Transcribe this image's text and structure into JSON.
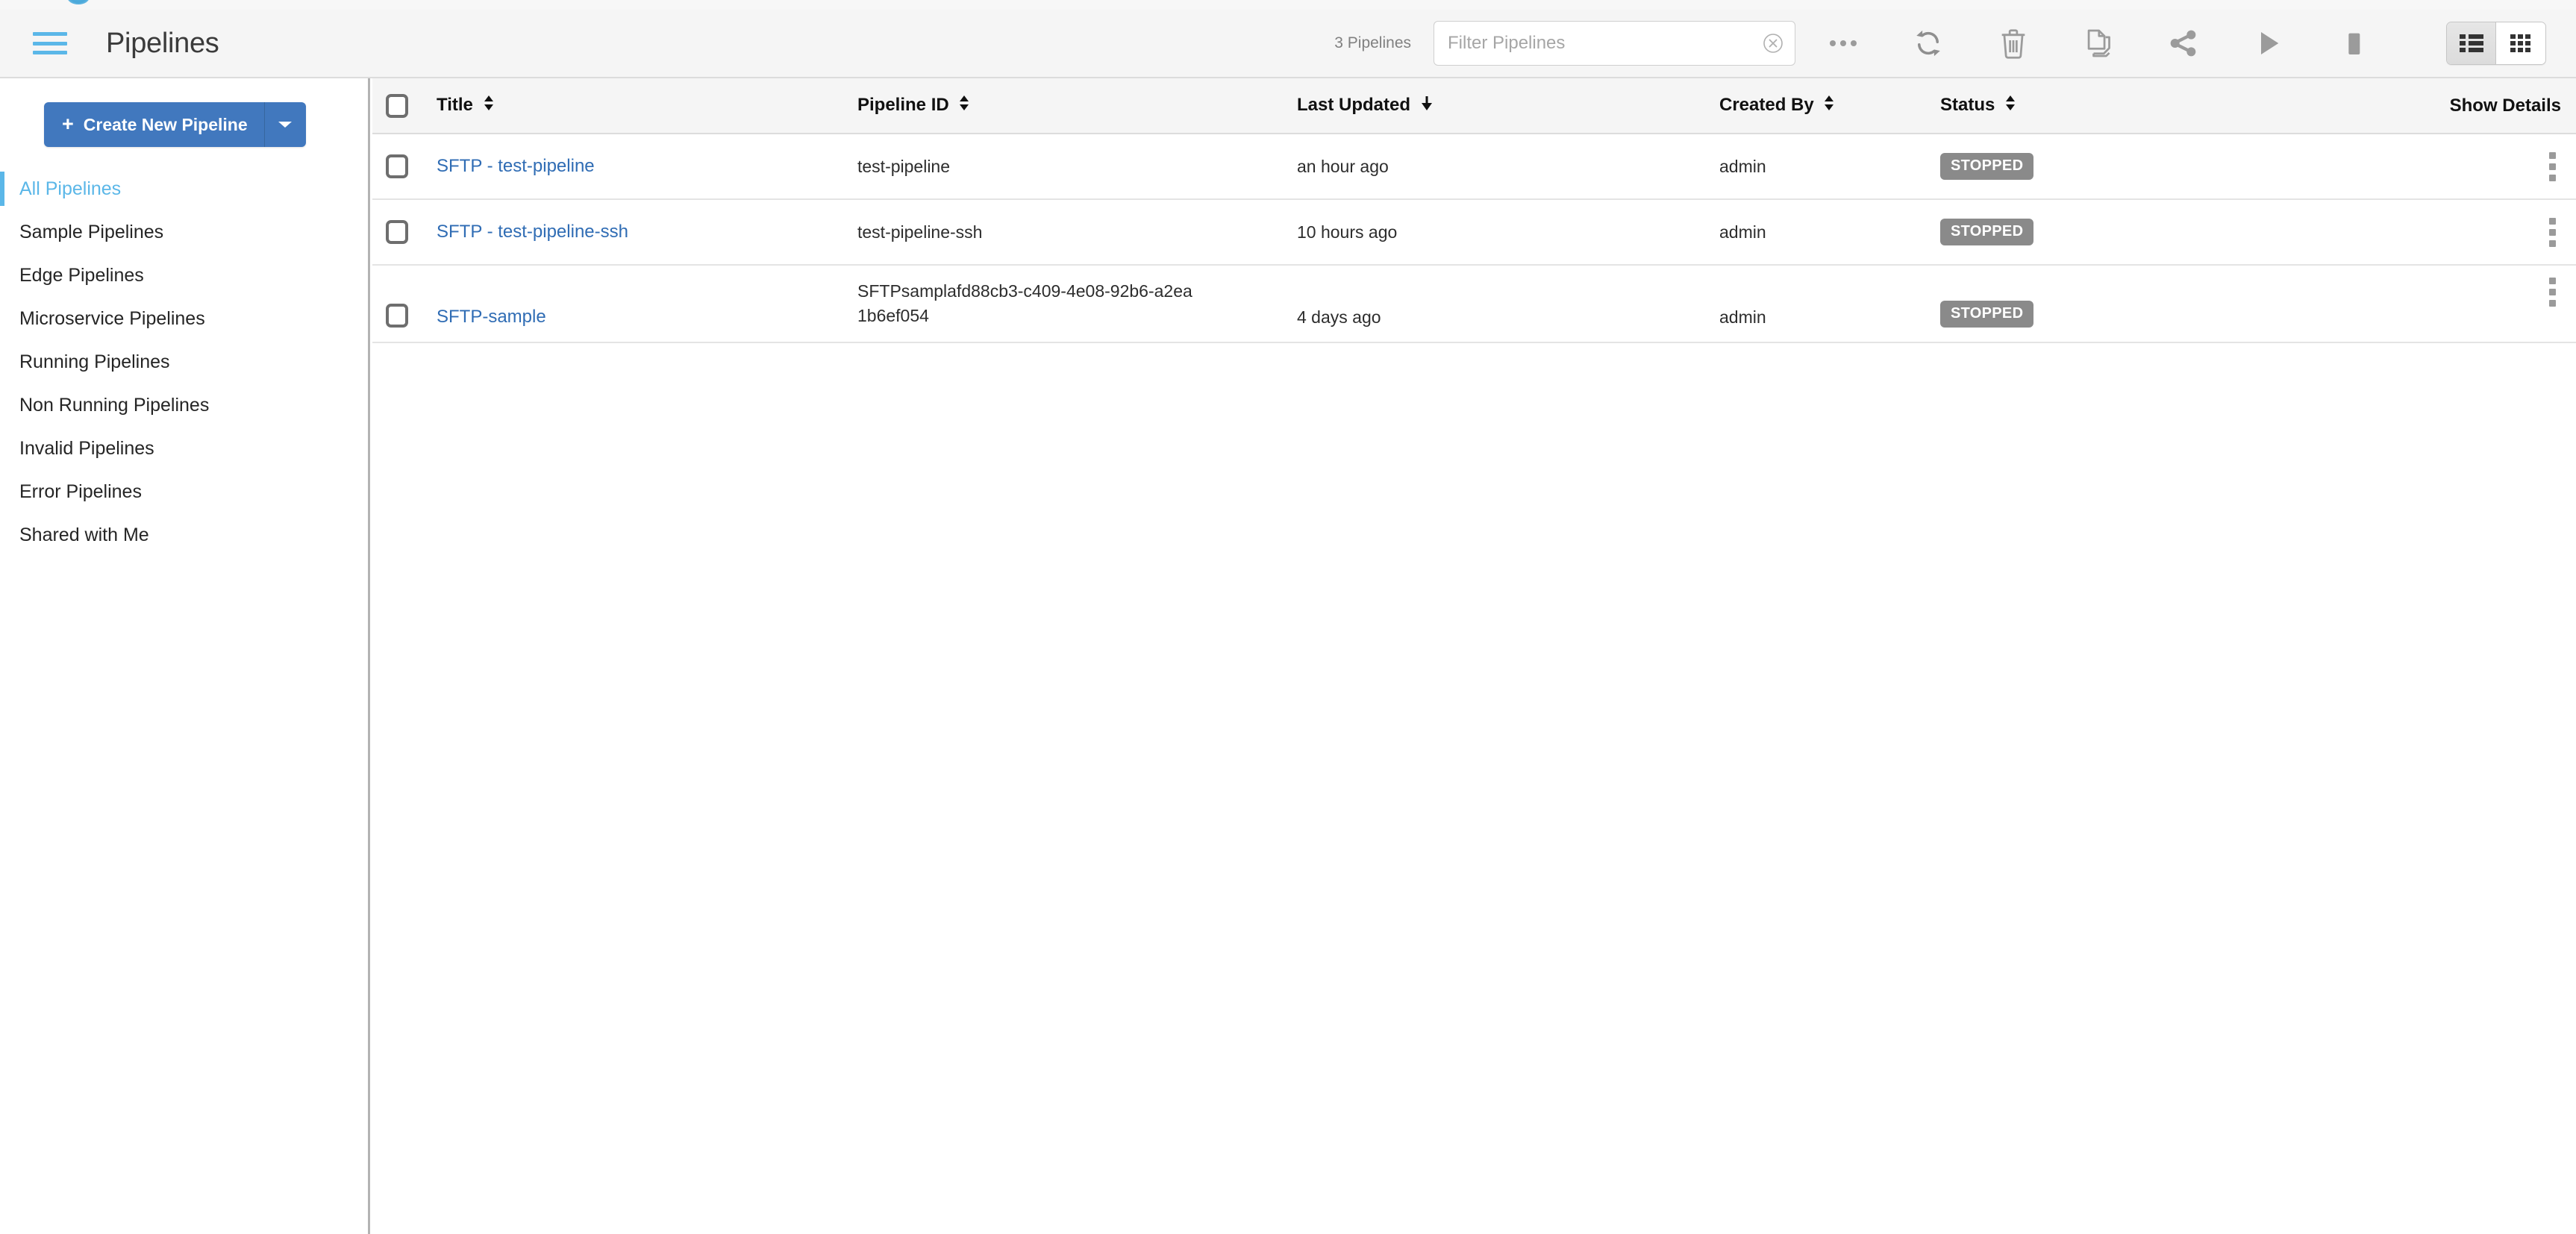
{
  "header": {
    "title": "Pipelines",
    "menu_icon": "hamburger-icon",
    "pipeline_count": "3 Pipelines",
    "filter": {
      "placeholder": "Filter Pipelines",
      "value": ""
    },
    "toolbar": [
      {
        "name": "more-icon",
        "label": "More"
      },
      {
        "name": "refresh-icon",
        "label": "Refresh"
      },
      {
        "name": "trash-icon",
        "label": "Delete"
      },
      {
        "name": "duplicate-icon",
        "label": "Duplicate"
      },
      {
        "name": "share-icon",
        "label": "Share"
      },
      {
        "name": "play-icon",
        "label": "Start"
      },
      {
        "name": "stop-icon",
        "label": "Stop"
      }
    ],
    "view_toggle": [
      {
        "name": "list-view-icon",
        "label": "List View",
        "active": true
      },
      {
        "name": "grid-view-icon",
        "label": "Grid View",
        "active": false
      }
    ]
  },
  "sidebar": {
    "create_button": {
      "label": "Create New Pipeline",
      "plus": "+",
      "caret": "▼"
    },
    "items": [
      {
        "label": "All Pipelines",
        "active": true
      },
      {
        "label": "Sample Pipelines",
        "active": false
      },
      {
        "label": "Edge Pipelines",
        "active": false
      },
      {
        "label": "Microservice Pipelines",
        "active": false
      },
      {
        "label": "Running Pipelines",
        "active": false
      },
      {
        "label": "Non Running Pipelines",
        "active": false
      },
      {
        "label": "Invalid Pipelines",
        "active": false
      },
      {
        "label": "Error Pipelines",
        "active": false
      },
      {
        "label": "Shared with Me",
        "active": false
      }
    ]
  },
  "table": {
    "columns": [
      {
        "key": "title",
        "label": "Title",
        "sort": "both"
      },
      {
        "key": "pipeline_id",
        "label": "Pipeline ID",
        "sort": "both"
      },
      {
        "key": "last_updated",
        "label": "Last Updated",
        "sort": "desc"
      },
      {
        "key": "created_by",
        "label": "Created By",
        "sort": "both"
      },
      {
        "key": "status",
        "label": "Status",
        "sort": "both"
      },
      {
        "key": "show_details",
        "label": "Show Details",
        "sort": "none"
      }
    ],
    "rows": [
      {
        "title": "SFTP - test-pipeline",
        "pipeline_id_line1": "test-pipeline",
        "pipeline_id_line2": "",
        "last_updated": "an hour ago",
        "created_by": "admin",
        "status": "STOPPED",
        "selected": false
      },
      {
        "title": "SFTP - test-pipeline-ssh",
        "pipeline_id_line1": "test-pipeline-ssh",
        "pipeline_id_line2": "",
        "last_updated": "10 hours ago",
        "created_by": "admin",
        "status": "STOPPED",
        "selected": false
      },
      {
        "title": "SFTP-sample",
        "pipeline_id_line1": "SFTPsamplafd88cb3-c409-4e08-92b6-a2ea",
        "pipeline_id_line2": "1b6ef054",
        "last_updated": "4 days ago",
        "created_by": "admin",
        "status": "STOPPED",
        "selected": false
      }
    ]
  },
  "colors": {
    "accent_blue": "#5bb7e8",
    "button_blue": "#4178be",
    "link_blue": "#2f6cb4",
    "status_gray": "#8a8a8a",
    "header_bg": "#f5f5f5"
  }
}
